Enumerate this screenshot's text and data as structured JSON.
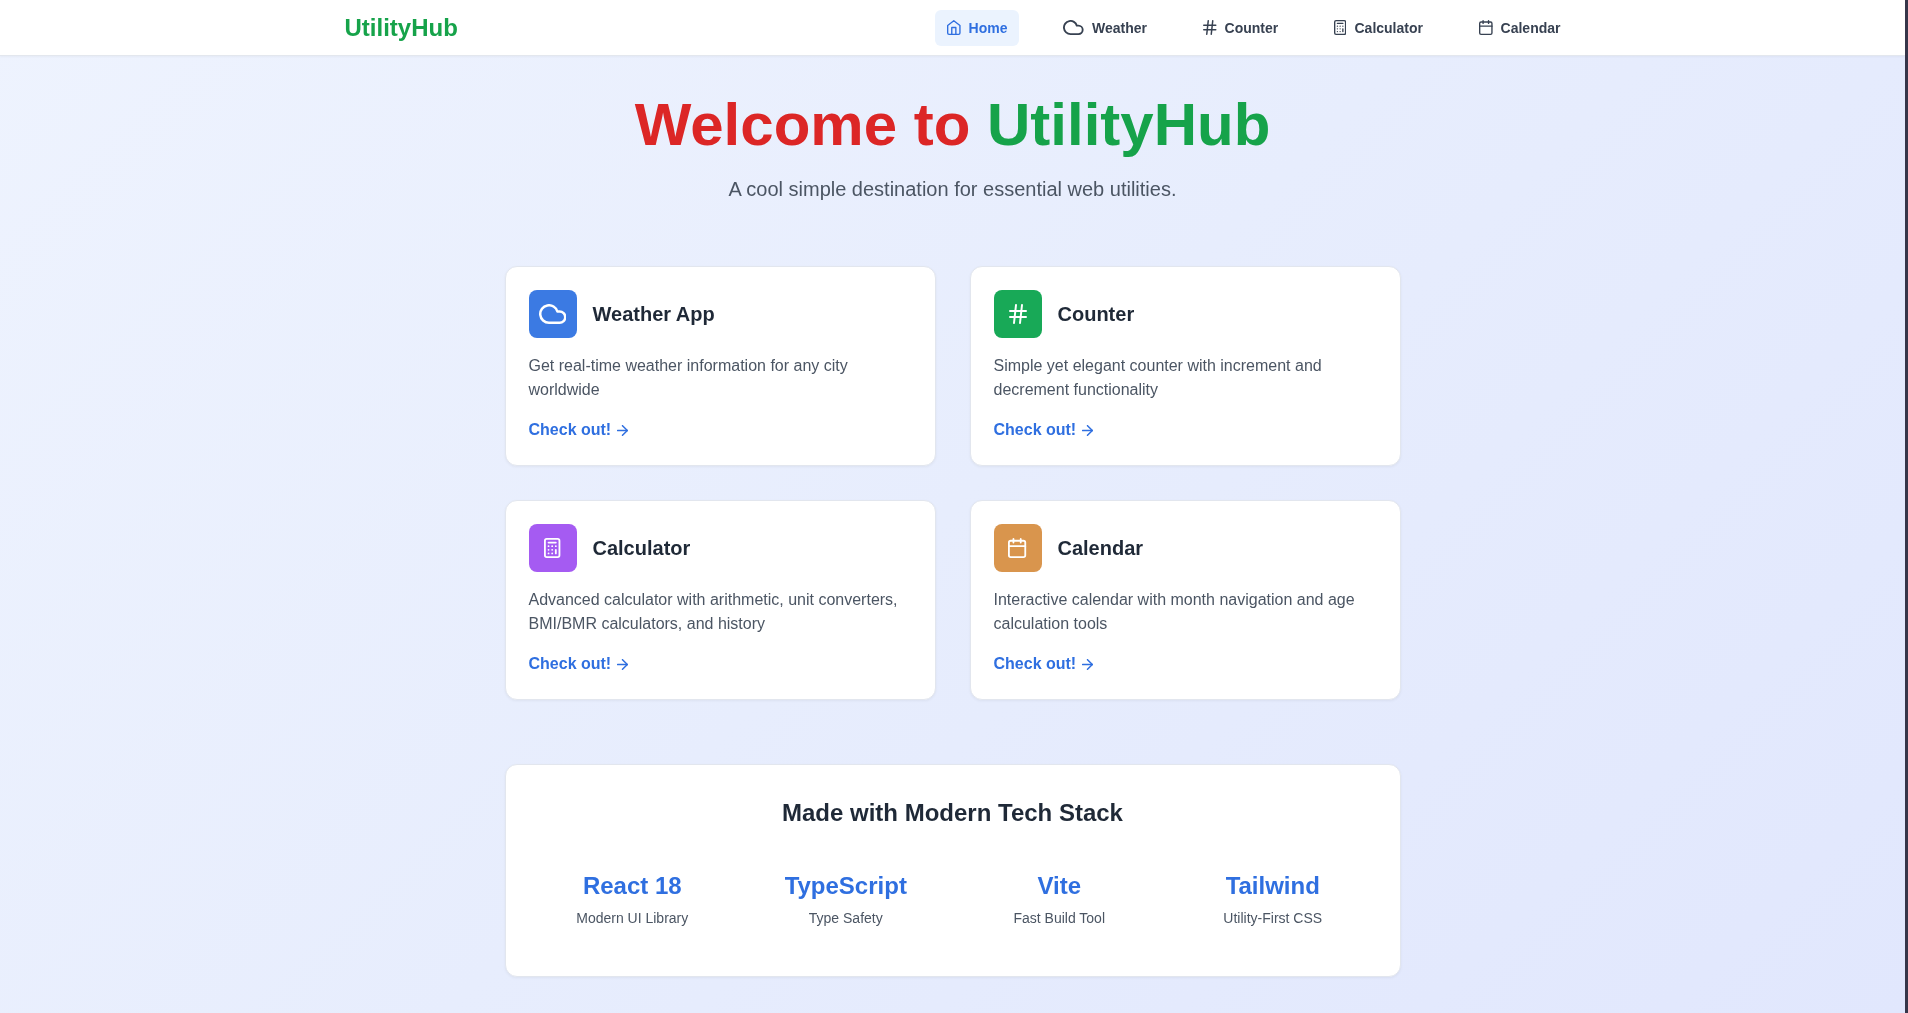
{
  "navbar": {
    "logo": "UtilityHub",
    "items": [
      {
        "label": "Home",
        "kind": "home",
        "selected": true
      },
      {
        "label": "Weather",
        "kind": "weather",
        "selected": false
      },
      {
        "label": "Counter",
        "kind": "counter",
        "selected": false
      },
      {
        "label": "Calculator",
        "kind": "calculator",
        "selected": false
      },
      {
        "label": "Calendar",
        "kind": "calendar",
        "selected": false
      }
    ]
  },
  "hero": {
    "title_start": "Welcome to",
    "title_highlight": "UtilityHub",
    "subtitle": "A cool simple destination for essential web utilities."
  },
  "features": [
    {
      "kind": "weather",
      "color": "#3b7ae3",
      "title": "Weather App",
      "description": "Get real-time weather information for any city worldwide",
      "link": "Check out!"
    },
    {
      "kind": "counter",
      "color": "#18a957",
      "title": "Counter",
      "description": "Simple yet elegant counter with increment and decrement functionality",
      "link": "Check out!"
    },
    {
      "kind": "calculator",
      "color": "#a55bf2",
      "title": "Calculator",
      "description": "Advanced calculator with arithmetic, unit converters, BMI/BMR calculators, and history",
      "link": "Check out!"
    },
    {
      "kind": "calendar",
      "color": "#d9954d",
      "title": "Calendar",
      "description": "Interactive calendar with month navigation and age calculation tools",
      "link": "Check out!"
    }
  ],
  "tech_stack": {
    "title": "Made with Modern Tech Stack",
    "items": [
      {
        "name": "React 18",
        "description": "Modern UI Library"
      },
      {
        "name": "TypeScript",
        "description": "Type Safety"
      },
      {
        "name": "Vite",
        "description": "Fast Build Tool"
      },
      {
        "name": "Tailwind",
        "description": "Utility-First CSS"
      }
    ]
  }
}
